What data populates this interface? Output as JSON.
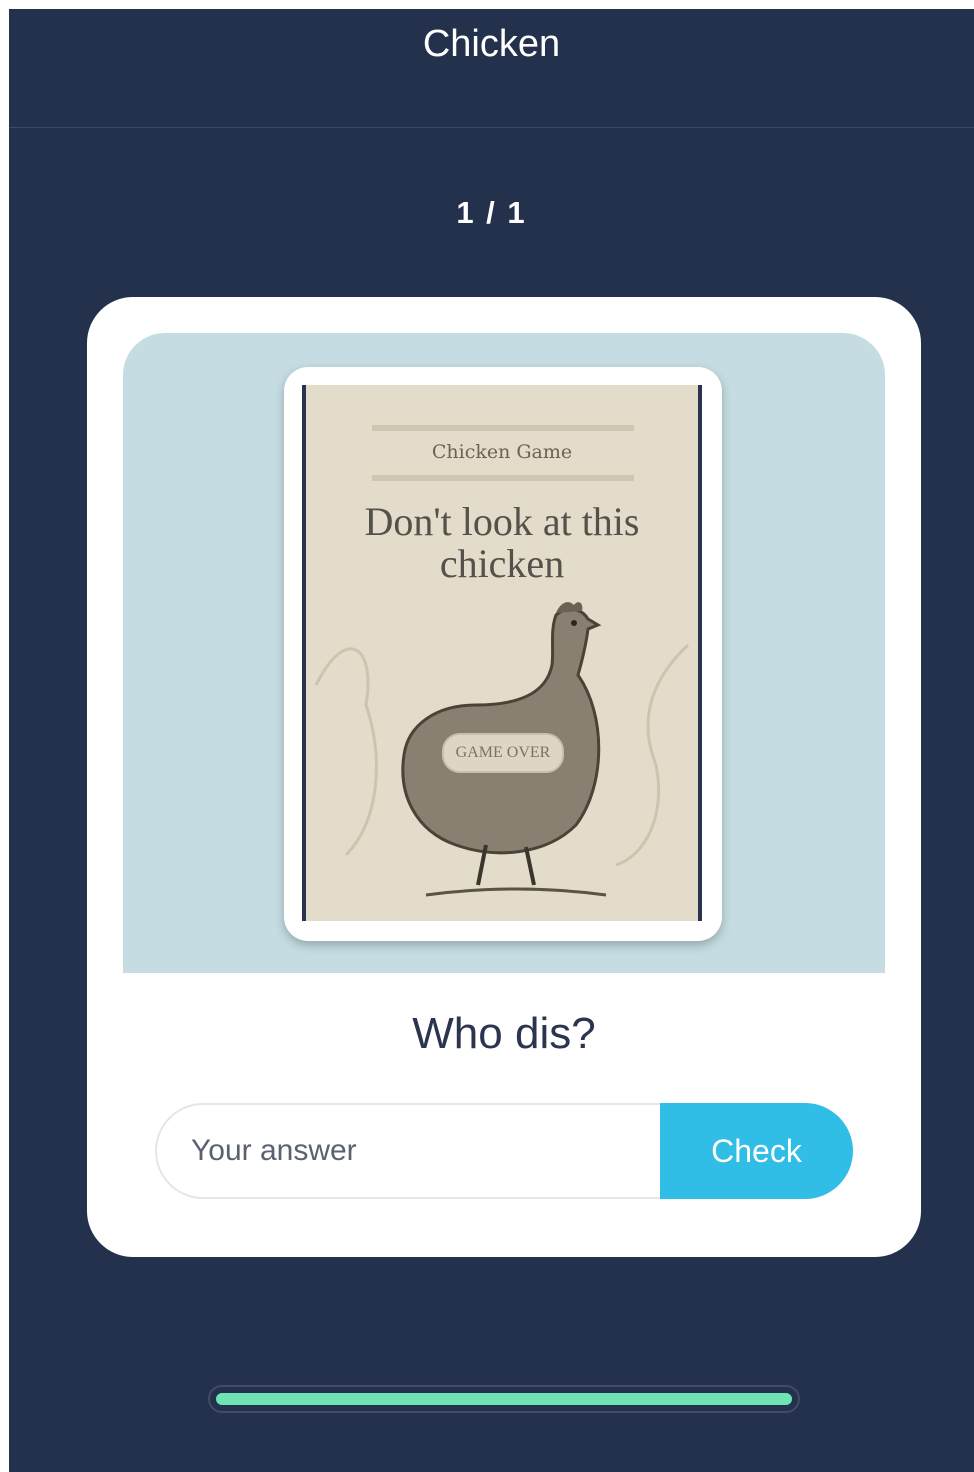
{
  "header": {
    "title": "Chicken"
  },
  "counter": "1 / 1",
  "card": {
    "poster": {
      "subtitle": "Chicken Game",
      "headline": "Don't look at this chicken",
      "stamp": "GAME OVER"
    },
    "question": "Who dis?",
    "answer": {
      "placeholder": "Your answer",
      "value": ""
    },
    "check_label": "Check"
  },
  "progress": {
    "fraction": 1.0
  },
  "colors": {
    "background": "#24314d",
    "accent": "#30bde6",
    "progress": "#6fe3b3",
    "image_panel": "#c5dde2"
  },
  "icons": [
    "chicken-illustration"
  ]
}
